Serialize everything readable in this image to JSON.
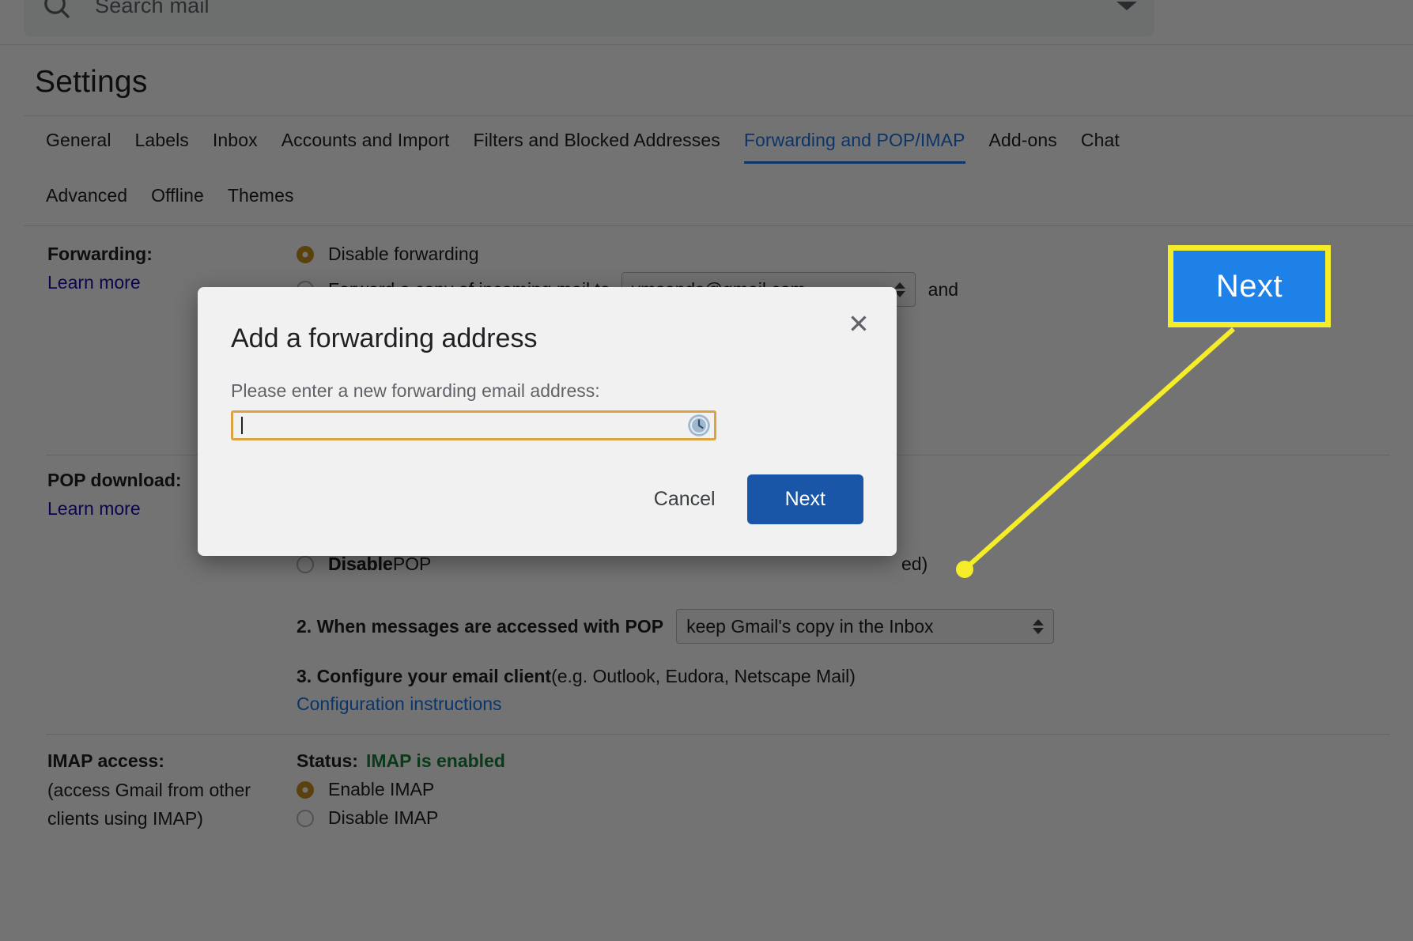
{
  "search": {
    "placeholder": "Search mail",
    "icon": "search-icon",
    "chevron": "chevron-down-icon"
  },
  "page_title": "Settings",
  "tabs": {
    "row1": [
      {
        "label": "General",
        "active": false
      },
      {
        "label": "Labels",
        "active": false
      },
      {
        "label": "Inbox",
        "active": false
      },
      {
        "label": "Accounts and Import",
        "active": false
      },
      {
        "label": "Filters and Blocked Addresses",
        "active": false
      },
      {
        "label": "Forwarding and POP/IMAP",
        "active": true
      },
      {
        "label": "Add-ons",
        "active": false
      },
      {
        "label": "Chat",
        "active": false
      }
    ],
    "row2": [
      {
        "label": "Advanced",
        "active": false
      },
      {
        "label": "Offline",
        "active": false
      },
      {
        "label": "Themes",
        "active": false
      }
    ]
  },
  "forwarding": {
    "label": "Forwarding:",
    "learn_more": "Learn more",
    "option_disable": "Disable forwarding",
    "option_forward_prefix": "Forward a copy of incoming mail to",
    "forward_address": "vmsands@gmail.com",
    "option_forward_suffix": "and"
  },
  "pop": {
    "label": "POP download:",
    "learn_more": "Learn more",
    "option_disable_bold": "Disable",
    "option_disable_rest": " POP",
    "step2_bold": "2. When messages are accessed with POP",
    "step2_select": "keep Gmail's copy in the Inbox",
    "step3_bold": "3. Configure your email client",
    "step3_rest": " (e.g. Outlook, Eudora, Netscape Mail)",
    "config_link": "Configuration instructions",
    "trailing_fragment": "ed)"
  },
  "imap": {
    "label": "IMAP access:",
    "sublabel_line1": "(access Gmail from other",
    "sublabel_line2": "clients using IMAP)",
    "status_prefix": "Status:",
    "status_value": "IMAP is enabled",
    "option_enable": "Enable IMAP",
    "option_disable": "Disable IMAP"
  },
  "dialog": {
    "title": "Add a forwarding address",
    "prompt": "Please enter a new forwarding email address:",
    "input_value": "",
    "input_placeholder": "",
    "close_icon": "close-icon",
    "history_icon": "clock-icon",
    "cancel_label": "Cancel",
    "next_label": "Next"
  },
  "annotation": {
    "callout_label": "Next",
    "callout_fill": "#1e81e8",
    "callout_border": "#f5ec2a",
    "line_color": "#f5ec2a"
  },
  "colors": {
    "accent_blue": "#1a73e8",
    "link_blue": "#1a0dab",
    "radio_amber": "#c9901f",
    "status_green": "#188038",
    "button_blue": "#1a56a8",
    "input_border_amber": "#d9a441"
  }
}
